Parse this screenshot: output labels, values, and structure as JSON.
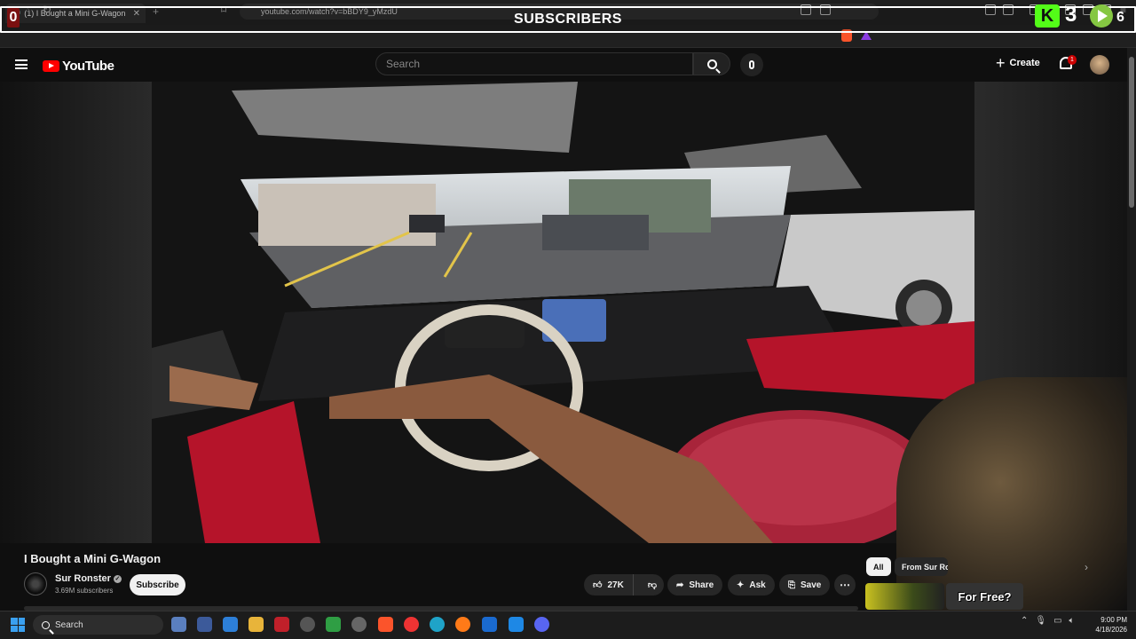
{
  "browser": {
    "tab_title": "(1) I Bought a Mini G-Wagon",
    "tab_close": "✕",
    "new_tab": "+",
    "url": "youtube.com/watch?v=bBDY9_yMzdU"
  },
  "overlay": {
    "banner": "SUBSCRIBERS",
    "left_counter": "0",
    "kick_logo": "K",
    "kick_count": "3",
    "rumble_count": "6"
  },
  "youtube": {
    "logo_text": "YouTube",
    "search_placeholder": "Search",
    "create_label": "Create",
    "create_plus": "+",
    "notification_count": "1"
  },
  "video": {
    "title": "I Bought a Mini G-Wagon",
    "channel_name": "Sur Ronster",
    "verified_mark": "✓",
    "subscribers": "3.69M subscribers",
    "subscribe_label": "Subscribe",
    "likes": "27K",
    "share_label": "Share",
    "ask_label": "Ask",
    "save_label": "Save",
    "more_label": "⋯"
  },
  "recommendations": {
    "chips": [
      "All",
      "From Sur Ronster"
    ],
    "next_arrow": "›",
    "thumb_text": "For Free?"
  },
  "taskbar": {
    "search_label": "Search",
    "time": "9:00 PM",
    "date": "4/18/2026"
  },
  "colors": {
    "youtube_red": "#ff0000",
    "kick_green": "#53fc18",
    "rumble_green": "#85c742",
    "interior_red": "#b5142a"
  },
  "icons": [
    "hamburger-icon",
    "search-icon",
    "mic-icon",
    "bell-icon",
    "like-icon",
    "dislike-icon",
    "share-icon",
    "ask-sparkle-icon",
    "save-icon",
    "windows-start-icon"
  ]
}
